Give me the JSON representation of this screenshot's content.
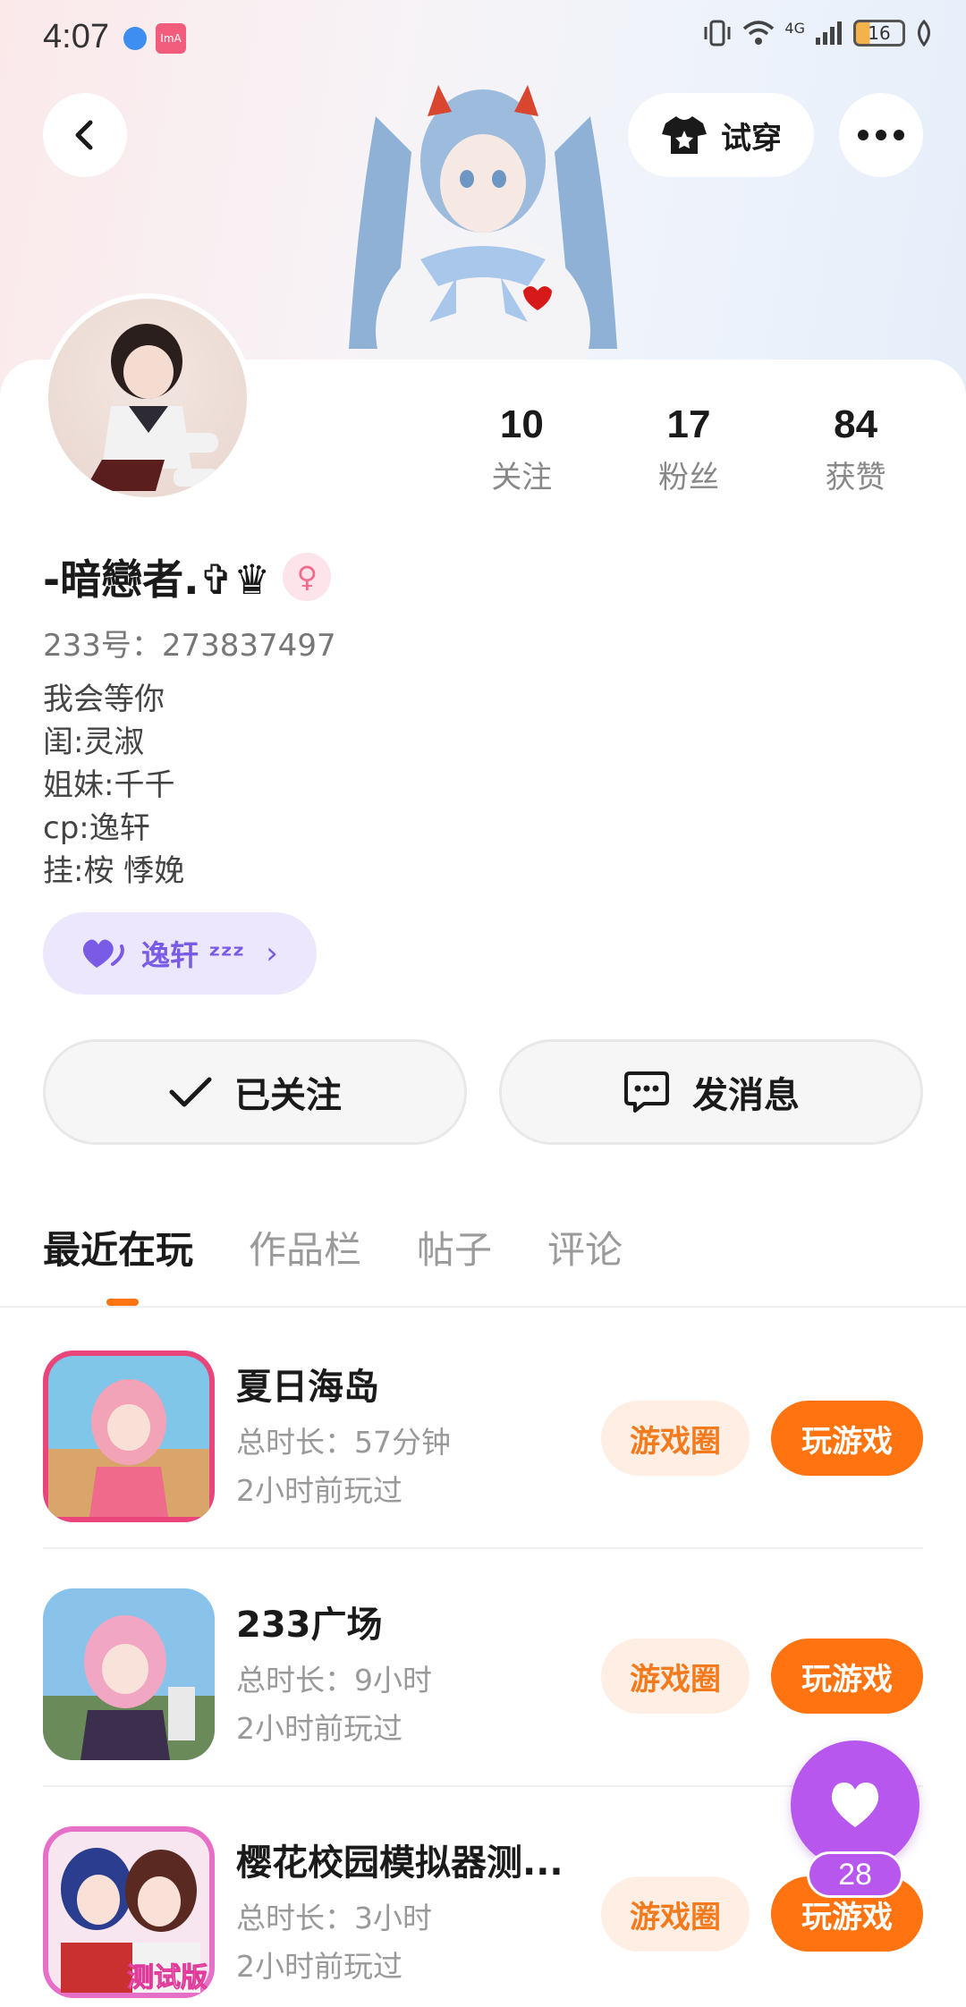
{
  "status_bar": {
    "time": "4:07",
    "app_badge": "ImA",
    "network": "4G",
    "battery": "16"
  },
  "header": {
    "tryon_label": "试穿"
  },
  "profile": {
    "stats": [
      {
        "value": "10",
        "label": "关注"
      },
      {
        "value": "17",
        "label": "粉丝"
      },
      {
        "value": "84",
        "label": "获赞"
      }
    ],
    "nickname": "-暗戀者.✞♛",
    "gender_symbol": "♀",
    "user_id": "233号：273837497",
    "bio_lines": [
      "我会等你",
      "闺:灵淑",
      "姐妹:千千",
      "cp:逸轩",
      "挂:桉 悸娩"
    ],
    "cp_chip": {
      "name": "逸轩 ᶻᶻᶻ",
      "arrow": "›"
    }
  },
  "actions": {
    "follow_label": "已关注",
    "message_label": "发消息"
  },
  "tabs": [
    "最近在玩",
    "作品栏",
    "帖子",
    "评论"
  ],
  "games": [
    {
      "title": "夏日海岛",
      "duration": "总时长：57分钟",
      "last_played": "2小时前玩过",
      "circle_label": "游戏圈",
      "play_label": "玩游戏"
    },
    {
      "title": "233广场",
      "duration": "总时长：9小时",
      "last_played": "2小时前玩过",
      "circle_label": "游戏圈",
      "play_label": "玩游戏"
    },
    {
      "title": "樱花校园模拟器测...",
      "duration": "总时长：3小时",
      "last_played": "2小时前玩过",
      "circle_label": "游戏圈",
      "play_label": "玩游戏",
      "icon_badge": "测试版"
    }
  ],
  "fab": {
    "count": "28"
  },
  "colors": {
    "accent": "#ff7410",
    "accent_light": "#ffeee4",
    "purple": "#b857ee",
    "cp_bg": "#ece7fd"
  }
}
